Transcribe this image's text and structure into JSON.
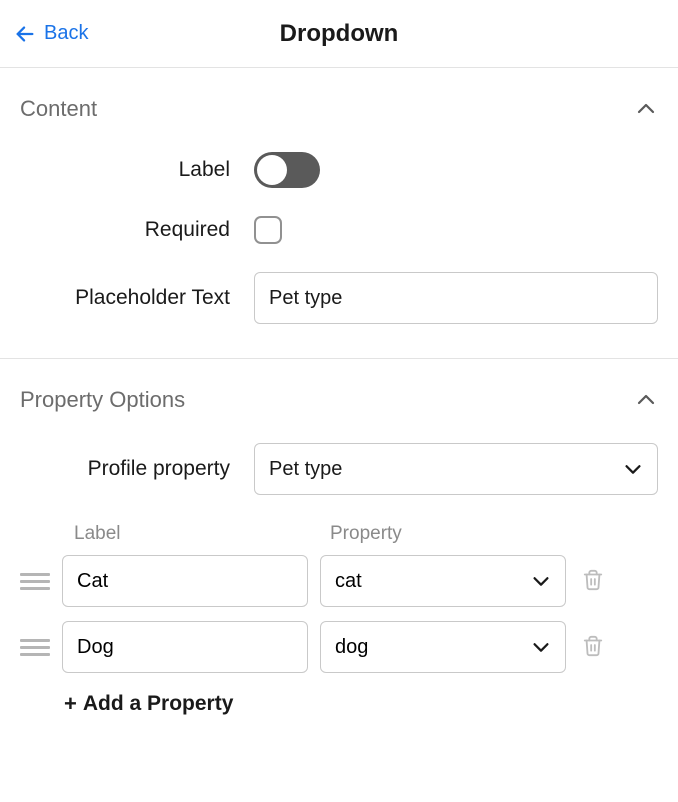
{
  "header": {
    "back_label": "Back",
    "title": "Dropdown"
  },
  "sections": {
    "content": {
      "title": "Content",
      "fields": {
        "label": {
          "label": "Label",
          "value": true
        },
        "required": {
          "label": "Required",
          "value": false
        },
        "placeholder": {
          "label": "Placeholder Text",
          "value": "Pet type"
        }
      }
    },
    "property_options": {
      "title": "Property Options",
      "profile_property": {
        "label": "Profile property",
        "value": "Pet type"
      },
      "columns": {
        "label": "Label",
        "property": "Property"
      },
      "options": [
        {
          "label": "Cat",
          "property": "cat"
        },
        {
          "label": "Dog",
          "property": "dog"
        }
      ],
      "add_label": "Add a Property"
    }
  }
}
